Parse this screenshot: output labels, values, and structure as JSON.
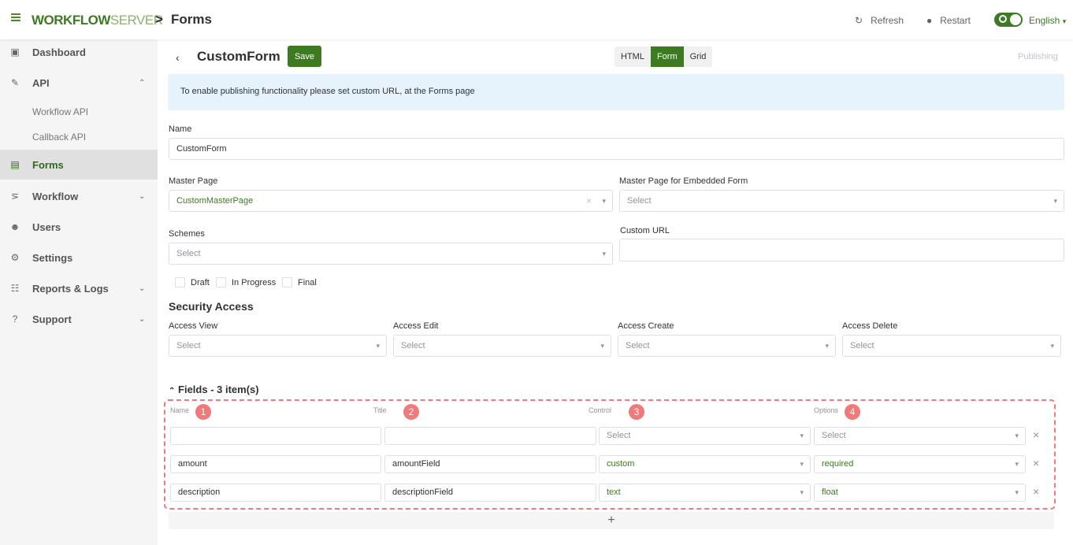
{
  "header": {
    "logo_bold": "ORKFLOW",
    "logo_w": "W",
    "logo_light": "SERVER",
    "separator": ">",
    "page_title": "Forms",
    "refresh": "Refresh",
    "restart": "Restart",
    "language": "English",
    "accent": "#3d7a22"
  },
  "sidebar": {
    "items": [
      {
        "label": "Dashboard",
        "icon": "dashboard-icon"
      },
      {
        "label": "API",
        "icon": "plug-icon",
        "expanded": true
      },
      {
        "label": "Forms",
        "icon": "forms-icon",
        "active": true
      },
      {
        "label": "Workflow",
        "icon": "workflow-icon"
      },
      {
        "label": "Users",
        "icon": "users-icon"
      },
      {
        "label": "Settings",
        "icon": "settings-icon"
      },
      {
        "label": "Reports & Logs",
        "icon": "reports-icon"
      },
      {
        "label": "Support",
        "icon": "help-icon"
      }
    ],
    "api_sub": [
      "Workflow API",
      "Callback API"
    ]
  },
  "form": {
    "title": "CustomForm",
    "save": "Save",
    "view_tabs": [
      "HTML",
      "Form",
      "Grid"
    ],
    "active_tab": "Form",
    "publishing": "Publishing",
    "info": "To enable publishing functionality please set custom URL, at the Forms page",
    "name_label": "Name",
    "name_value": "CustomForm",
    "master_label": "Master Page",
    "master_value": "CustomMasterPage",
    "embedded_label": "Master Page for Embedded Form",
    "select_ph": "Select",
    "schemes_label": "Schemes",
    "custom_url_label": "Custom URL",
    "custom_url_value": "",
    "checks": [
      "Draft",
      "In Progress",
      "Final"
    ],
    "security_title": "Security Access",
    "access": [
      "Access View",
      "Access Edit",
      "Access Create",
      "Access Delete"
    ]
  },
  "fields": {
    "title": "Fields - 3 item(s)",
    "columns": [
      "Name",
      "Title",
      "Control",
      "Options"
    ],
    "badges": [
      "1",
      "2",
      "3",
      "4"
    ],
    "rows": [
      {
        "name": "",
        "title": "",
        "control": "Select",
        "options": "Select"
      },
      {
        "name": "amount",
        "title": "amountField",
        "control": "custom",
        "options": "required"
      },
      {
        "name": "description",
        "title": "descriptionField",
        "control": "text",
        "options": "float"
      }
    ],
    "add": "+",
    "remove": "×"
  }
}
